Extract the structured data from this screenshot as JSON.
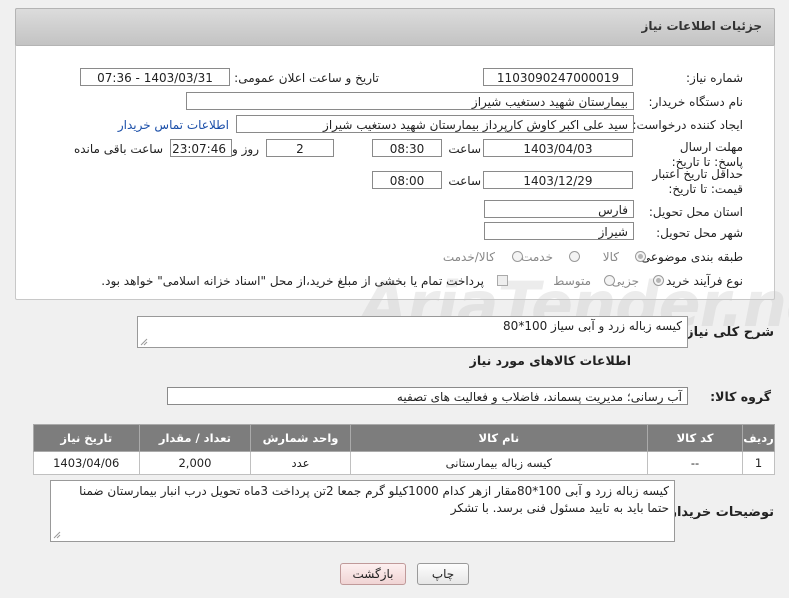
{
  "header": {
    "title": "جزئیات اطلاعات نیاز"
  },
  "fields": {
    "need_number_label": "شماره نیاز:",
    "need_number": "1103090247000019",
    "announce_label": "تاریخ و ساعت اعلان عمومی:",
    "announce_value": "1403/03/31 - 07:36",
    "buyer_org_label": "نام دستگاه خریدار:",
    "buyer_org": "بیمارستان شهید دستغیب شیراز",
    "creator_label": "ایجاد کننده درخواست:",
    "creator": "سید علی اکبر کاوش کارپرداز بیمارستان شهید دستغیب شیراز",
    "contact_link": "اطلاعات تماس خریدار",
    "reply_deadline_label": "مهلت ارسال پاسخ: تا تاریخ:",
    "reply_date": "1403/04/03",
    "time_label": "ساعت",
    "reply_time": "08:30",
    "days_value": "2",
    "days_label": "روز و",
    "remaining_time": "23:07:46",
    "remaining_label": "ساعت باقی مانده",
    "validity_label": "حداقل تاریخ اعتبار قیمت: تا تاریخ:",
    "validity_date": "1403/12/29",
    "validity_time": "08:00",
    "province_label": "استان محل تحویل:",
    "province": "فارس",
    "city_label": "شهر محل تحویل:",
    "city": "شیراز",
    "category_label": "طبقه بندی موضوعی:",
    "category_options": [
      "کالا",
      "خدمت",
      "کالا/خدمت"
    ],
    "purchase_type_label": "نوع فرآیند خرید :",
    "purchase_options": [
      "جزیی",
      "متوسط"
    ],
    "payment_note": "پرداخت تمام یا بخشی از مبلغ خرید،از محل \"اسناد خزانه اسلامی\" خواهد بود."
  },
  "description": {
    "label": "شرح کلی نیاز:",
    "value": "کیسه زباله زرد و آبی سیاز 100*80"
  },
  "goods_section": {
    "title": "اطلاعات کالاهای مورد نیاز",
    "group_label": "گروه کالا:",
    "group_value": "آب رسانی؛ مدیریت پسماند، فاضلاب و فعالیت های تصفیه"
  },
  "table": {
    "headers": [
      "ردیف",
      "کد کالا",
      "نام کالا",
      "واحد شمارش",
      "تعداد / مقدار",
      "تاریخ نیاز"
    ],
    "rows": [
      [
        "1",
        "--",
        "کیسه زباله بیمارستانی",
        "عدد",
        "2,000",
        "1403/04/06"
      ]
    ]
  },
  "buyer_notes": {
    "label": "توضیحات خریدار:",
    "value": "کیسه زباله زرد و آبی 100*80مقار ازهر کدام 1000کیلو گرم جمعا 2تن پرداخت 3ماه تحویل درب انبار بیمارستان ضمنا حتما باید به تایید مسئول فنی برسد. با تشکر"
  },
  "buttons": {
    "print": "چاپ",
    "back": "بازگشت"
  },
  "watermark": "AriaTender.neT",
  "colors": {
    "table_header": "#7d7d7d",
    "link": "#1a4ea8",
    "back_button": "#f6dede"
  }
}
